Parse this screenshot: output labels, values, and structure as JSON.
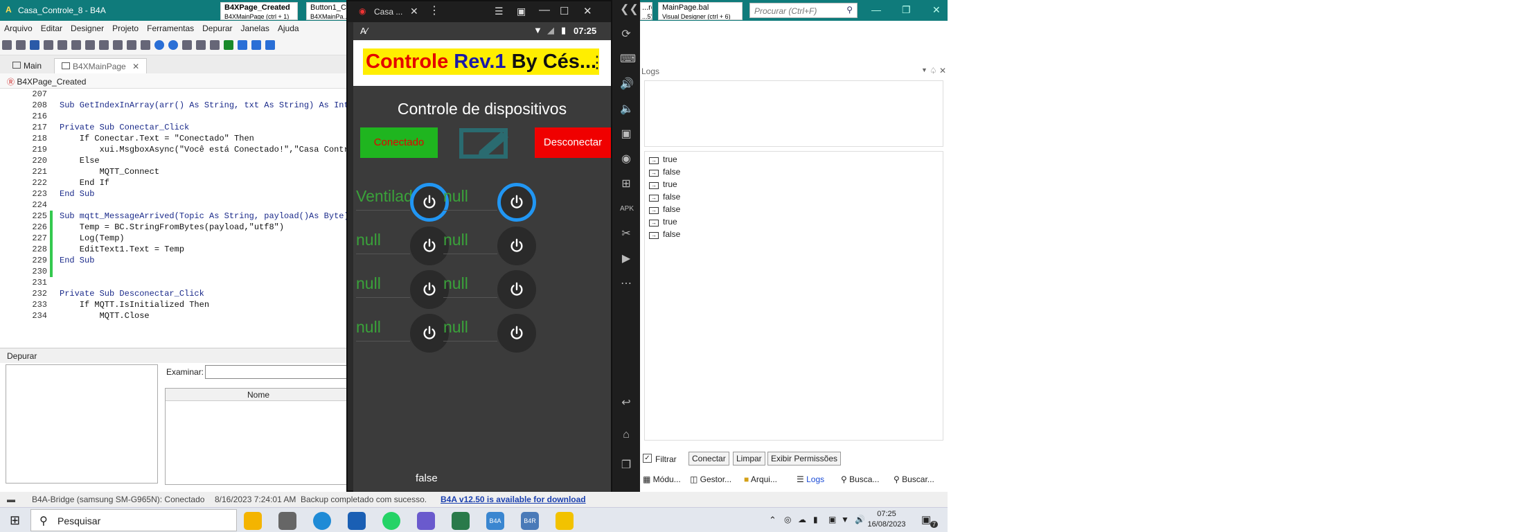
{
  "ide": {
    "title": "Casa_Controle_8 - B4A",
    "window_tabs": [
      {
        "title": "B4XPage_Created",
        "sub": "B4XMainPage  (ctrl + 1)"
      },
      {
        "title": "Button1_C...",
        "sub": "B4XMainPa..."
      },
      {
        "title": "...red",
        "sub": "...5)"
      },
      {
        "title": "MainPage.bal",
        "sub": "Visual Designer  (ctrl + 6)"
      }
    ],
    "search_placeholder": "Procurar (Ctrl+F)",
    "menu": [
      "Arquivo",
      "Editar",
      "Designer",
      "Projeto",
      "Ferramentas",
      "Depurar",
      "Janelas",
      "Ajuda"
    ],
    "tabs": [
      "Main",
      "B4XMainPage"
    ],
    "sub_dropdown": "B4XPage_Created",
    "code_lines": [
      {
        "n": "207",
        "t": ""
      },
      {
        "n": "208",
        "t": "Sub GetIndexInArray(arr() As String, txt As String) As Int"
      },
      {
        "n": "216",
        "t": ""
      },
      {
        "n": "217",
        "t": "Private Sub Conectar_Click"
      },
      {
        "n": "218",
        "t": "    If Conectar.Text = \"Conectado\" Then"
      },
      {
        "n": "219",
        "t": "        xui.MsgboxAsync(\"Você está Conectado!\",\"Casa Contr"
      },
      {
        "n": "220",
        "t": "    Else"
      },
      {
        "n": "221",
        "t": "        MQTT_Connect"
      },
      {
        "n": "222",
        "t": "    End If"
      },
      {
        "n": "223",
        "t": "End Sub"
      },
      {
        "n": "224",
        "t": ""
      },
      {
        "n": "225",
        "t": "Sub mqtt_MessageArrived(Topic As String, payload()As Byte)"
      },
      {
        "n": "226",
        "t": "    Temp = BC.StringFromBytes(payload,\"utf8\")"
      },
      {
        "n": "227",
        "t": "    Log(Temp)"
      },
      {
        "n": "228",
        "t": "    EditText1.Text = Temp"
      },
      {
        "n": "229",
        "t": "End Sub"
      },
      {
        "n": "230",
        "t": ""
      },
      {
        "n": "231",
        "t": ""
      },
      {
        "n": "232",
        "t": "Private Sub Desconectar_Click"
      },
      {
        "n": "233",
        "t": "    If MQTT.IsInitialized Then"
      },
      {
        "n": "234",
        "t": "        MQTT.Close"
      }
    ],
    "debug_title": "Depurar",
    "examinar_label": "Examinar:",
    "grid_header": "Nome",
    "logs_title": "Logs",
    "log_lines": [
      "true",
      "false",
      "true",
      "false",
      "false",
      "true",
      "false"
    ],
    "filter_label": "Filtrar",
    "connect_label": "Conectar",
    "clear_label": "Limpar",
    "permissions_label": "Exibir Permissões",
    "panel_tabs": [
      "Módu...",
      "Gestor...",
      "Arqui...",
      "Logs",
      "Busca...",
      "Buscar..."
    ],
    "status_bridge": "B4A-Bridge (samsung SM-G965N): Conectado",
    "status_time": "8/16/2023 7:24:01 AM",
    "status_backup": "Backup completado com sucesso.",
    "status_update": "B4A v12.50 is available for download"
  },
  "emulator": {
    "window_title": "Casa ...",
    "status_time": "07:25",
    "app_title_part1": "Controle ",
    "app_title_part2": "Rev.1",
    "app_title_part3": " By Cés...",
    "section_title": "Controle de dispositivos",
    "connect_button": "Conectado",
    "disconnect_button": "Desconectar",
    "devices": [
      {
        "label": "Ventilador",
        "on": true
      },
      {
        "label": "null",
        "on": true
      },
      {
        "label": "null",
        "on": false
      },
      {
        "label": "null",
        "on": false
      },
      {
        "label": "null",
        "on": false
      },
      {
        "label": "null",
        "on": false
      },
      {
        "label": "null",
        "on": false
      },
      {
        "label": "null",
        "on": false
      }
    ],
    "bottom_text": "false",
    "colors": {
      "connect_bg": "#1fb51f",
      "disconnect_bg": "#f00000",
      "power_ring": "#2196f3",
      "label_green": "#3aa23a"
    }
  },
  "taskbar": {
    "search_text": "Pesquisar",
    "time": "07:25",
    "date": "16/08/2023",
    "notification_count": "7"
  }
}
